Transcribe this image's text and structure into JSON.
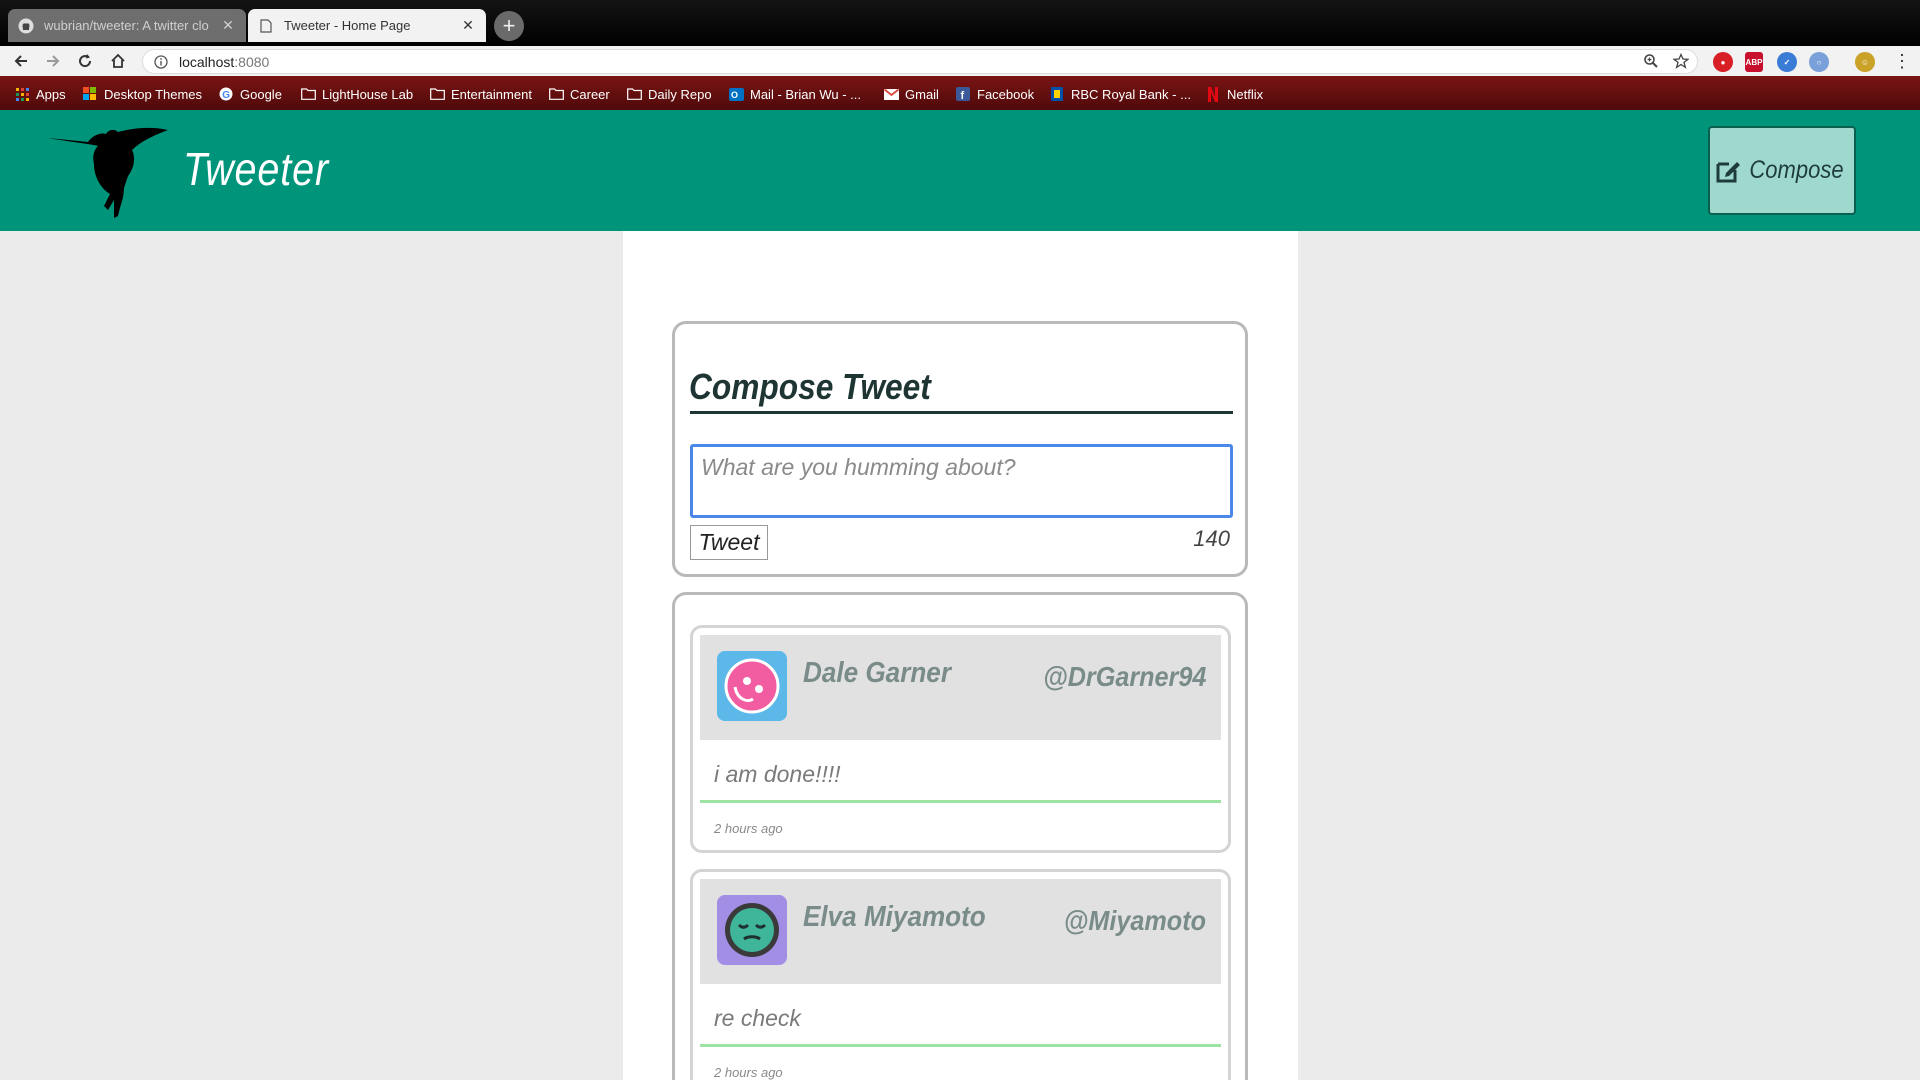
{
  "browser": {
    "tabs": [
      {
        "title": "wubrian/tweeter: A twitter clo",
        "favicon": "github-icon",
        "active": false
      },
      {
        "title": "Tweeter - Home Page",
        "favicon": "page-icon",
        "active": true
      }
    ],
    "address": {
      "host": "localhost",
      "port": ":8080"
    },
    "bookmarks": [
      {
        "label": "Apps",
        "icon": "apps-grid-icon"
      },
      {
        "label": "Desktop Themes",
        "icon": "windows-icon"
      },
      {
        "label": "Google",
        "icon": "google-icon"
      },
      {
        "label": "LightHouse Lab",
        "icon": "folder-icon"
      },
      {
        "label": "Entertainment",
        "icon": "folder-icon"
      },
      {
        "label": "Career",
        "icon": "folder-icon"
      },
      {
        "label": "Daily Repo",
        "icon": "folder-icon"
      },
      {
        "label": "Mail - Brian Wu - ...",
        "icon": "outlook-icon"
      },
      {
        "label": "Gmail",
        "icon": "gmail-icon"
      },
      {
        "label": "Facebook",
        "icon": "facebook-icon"
      },
      {
        "label": "RBC Royal Bank - ...",
        "icon": "rbc-icon"
      },
      {
        "label": "Netflix",
        "icon": "netflix-icon"
      }
    ]
  },
  "header": {
    "brand": "Tweeter",
    "compose_label": "Compose"
  },
  "compose": {
    "title": "Compose Tweet",
    "placeholder": "What are you humming about?",
    "submit_label": "Tweet",
    "counter": "140"
  },
  "tweets": [
    {
      "name": "Dale Garner",
      "handle": "@DrGarner94",
      "content": "i am done!!!!",
      "time": "2 hours ago",
      "avatar_bg": "#5bb8e8",
      "avatar_face": "#f25ca0"
    },
    {
      "name": "Elva Miyamoto",
      "handle": "@Miyamoto",
      "content": "re check",
      "time": "2 hours ago",
      "avatar_bg": "#a38ee6",
      "avatar_face": "#3fb59a"
    }
  ],
  "colors": {
    "header_bg": "#00957a",
    "compose_btn_bg": "#9fd9ce",
    "accent_line": "#9de4a4",
    "page_bg": "#ebebeb"
  }
}
